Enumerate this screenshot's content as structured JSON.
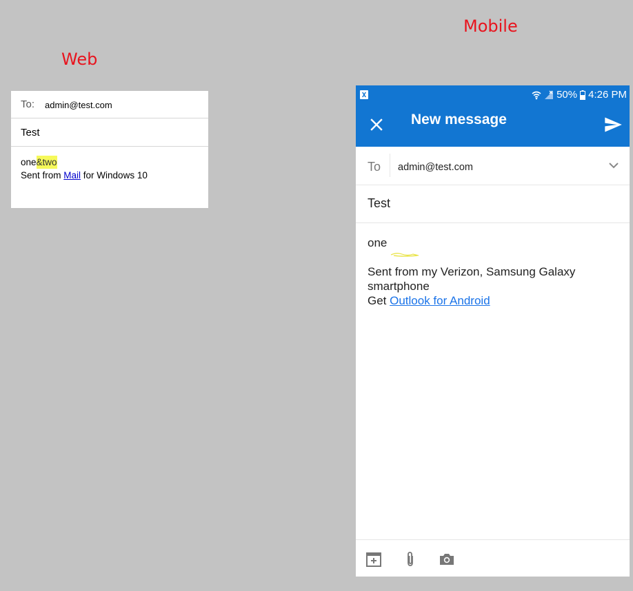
{
  "captions": {
    "web": "Web",
    "mobile": "Mobile"
  },
  "web": {
    "to_label": "To:",
    "to_value": "admin@test.com",
    "subject": "Test",
    "body_plain": "one",
    "body_highlight": "&two",
    "sig_prefix": "Sent from ",
    "sig_link": "Mail",
    "sig_suffix": " for Windows 10"
  },
  "mobile": {
    "status": {
      "battery": "50%",
      "time": "4:26 PM"
    },
    "title": "New message",
    "to_label": "To",
    "to_value": "admin@test.com",
    "subject": "Test",
    "body_text": "one",
    "signature_line1": "Sent from my Verizon, Samsung Galaxy",
    "signature_line2": "smartphone",
    "get_prefix": "Get ",
    "get_link": "Outlook for Android",
    "icons": [
      "close-icon",
      "send-icon",
      "chevron-down-icon",
      "add-event-icon",
      "attachment-icon",
      "camera-icon"
    ]
  },
  "colors": {
    "accent": "#1276d2",
    "caption": "#e8141e",
    "highlight": "#f6f95a",
    "link": "#1a73e8"
  }
}
